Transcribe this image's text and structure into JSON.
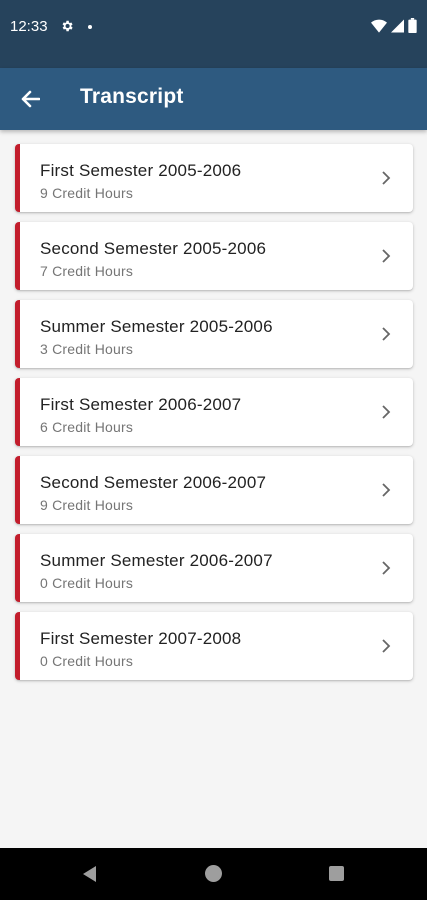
{
  "status_bar": {
    "time": "12:33",
    "icons": [
      "gear-icon",
      "notification-dot-icon",
      "wifi-icon",
      "signal-icon",
      "battery-icon"
    ]
  },
  "app_bar": {
    "title": "Transcript",
    "back_icon": "arrow-left-icon",
    "background": "#2e5a80"
  },
  "colors": {
    "accent": "#c21d2c",
    "status_bar": "#26435c"
  },
  "semesters": [
    {
      "title": "First Semester 2005-2006",
      "credits": "9 Credit Hours"
    },
    {
      "title": "Second Semester 2005-2006",
      "credits": "7 Credit Hours"
    },
    {
      "title": "Summer Semester 2005-2006",
      "credits": "3 Credit Hours"
    },
    {
      "title": "First Semester 2006-2007",
      "credits": "6 Credit Hours"
    },
    {
      "title": "Second Semester 2006-2007",
      "credits": "9 Credit Hours"
    },
    {
      "title": "Summer Semester 2006-2007",
      "credits": "0 Credit Hours"
    },
    {
      "title": "First Semester 2007-2008",
      "credits": "0 Credit Hours"
    }
  ],
  "nav_bar": {
    "icons": [
      "back-triangle-icon",
      "home-circle-icon",
      "recents-square-icon"
    ]
  }
}
